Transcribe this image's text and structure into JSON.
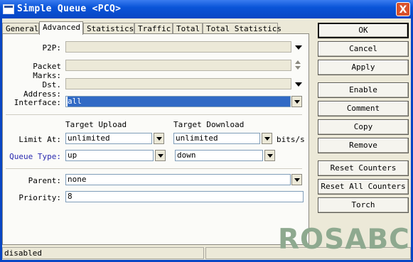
{
  "window": {
    "title": "Simple Queue <PCQ>",
    "close": "X"
  },
  "tabs": [
    "General",
    "Advanced",
    "Statistics",
    "Traffic",
    "Total",
    "Total Statistics"
  ],
  "form": {
    "p2p": {
      "label": "P2P:",
      "value": ""
    },
    "packet_marks": {
      "label": "Packet Marks:",
      "value": ""
    },
    "dst_address": {
      "label": "Dst. Address:",
      "value": ""
    },
    "interface": {
      "label": "Interface:",
      "value": "all"
    },
    "target_upload_header": "Target Upload",
    "target_download_header": "Target Download",
    "limit_at": {
      "label": "Limit At:",
      "upload": "unlimited",
      "download": "unlimited",
      "unit": "bits/s"
    },
    "queue_type": {
      "label": "Queue Type:",
      "upload": "up",
      "download": "down"
    },
    "parent": {
      "label": "Parent:",
      "value": "none"
    },
    "priority": {
      "label": "Priority:",
      "value": "8"
    }
  },
  "buttons": [
    "OK",
    "Cancel",
    "Apply",
    "Enable",
    "Comment",
    "Copy",
    "Remove",
    "Reset Counters",
    "Reset All Counters",
    "Torch"
  ],
  "status": {
    "text": "disabled"
  },
  "watermark": "ROSABC"
}
